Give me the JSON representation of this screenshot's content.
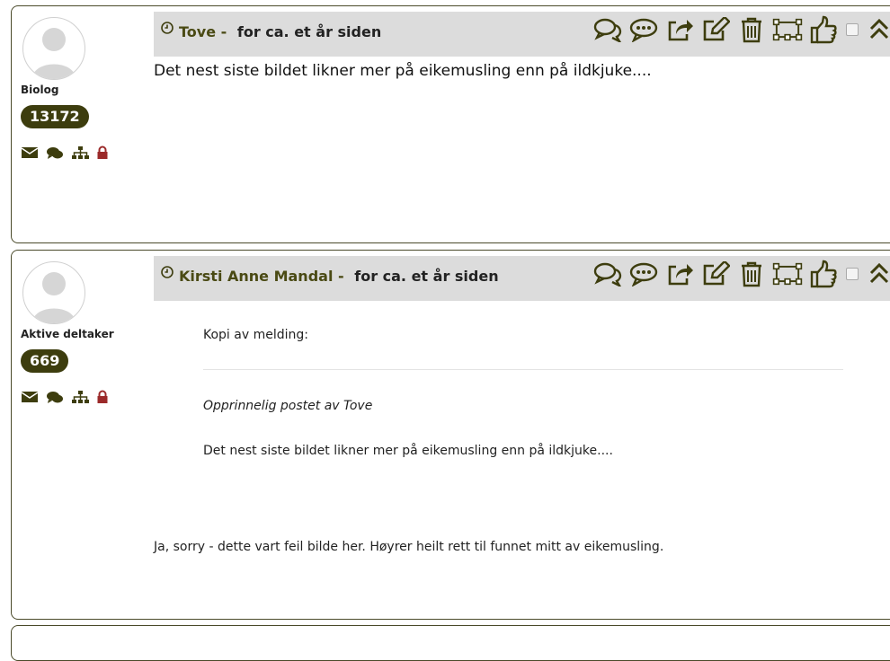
{
  "posts": [
    {
      "author": "Tove",
      "separator": "-",
      "time": "for ca. et år siden",
      "rank": "Biolog",
      "count": "13172",
      "body": "Det nest siste bildet likner mer på eikemusling enn på ildkjuke...."
    },
    {
      "author": "Kirsti Anne Mandal",
      "separator": "-",
      "time": "for ca. et år siden",
      "rank": "Aktive deltaker",
      "count": "669",
      "quote_label": "Kopi av melding:",
      "quote_original": "Opprinnelig postet av Tove",
      "quote_text": "Det nest siste bildet likner mer på eikemusling enn på ildkjuke....",
      "body": "Ja, sorry - dette vart feil bilde her. Høyrer heilt rett til funnet mitt av eikemusling."
    }
  ],
  "icons": {
    "user_icons": [
      "envelope-icon",
      "chat-icon",
      "sitemap-icon",
      "lock-icon"
    ],
    "actions": [
      "comments-icon",
      "comment-dots-icon",
      "share-icon",
      "edit-icon",
      "trash-icon",
      "crop-icon",
      "thumbs-up-icon",
      "select-checkbox",
      "collapse-icon"
    ]
  },
  "colors": {
    "accent": "#3d3d0e",
    "header_bg": "#dcdcdc",
    "lock": "#9b2a2a"
  }
}
